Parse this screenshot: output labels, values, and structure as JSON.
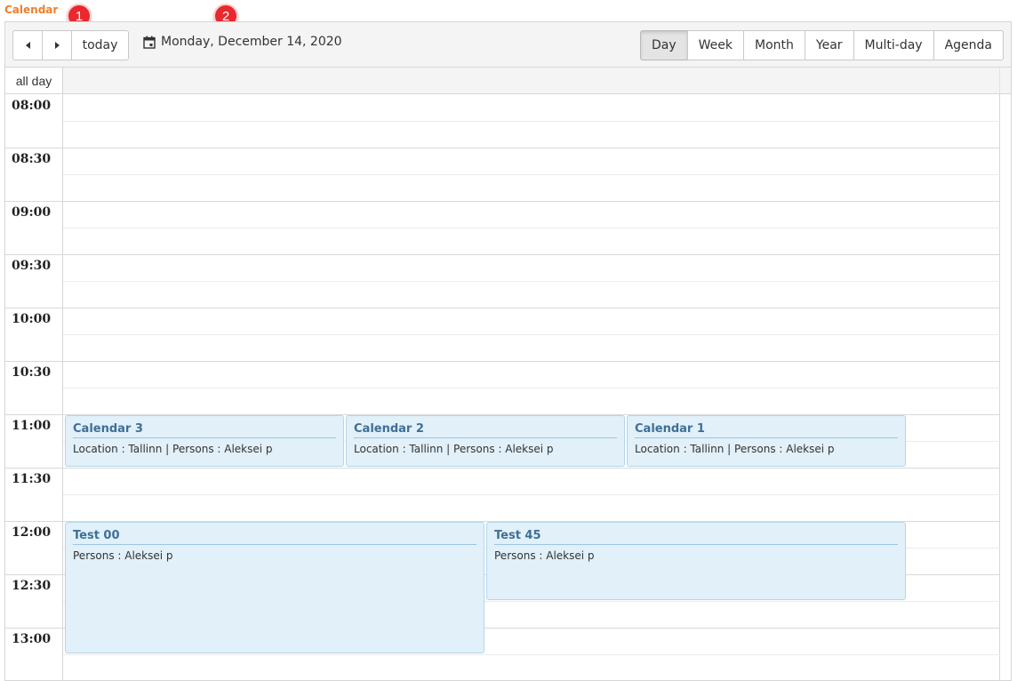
{
  "app": {
    "title": "Calendar"
  },
  "markers": [
    "1",
    "2"
  ],
  "toolbar": {
    "prev_icon": "caret-left-icon",
    "next_icon": "caret-right-icon",
    "today_label": "today",
    "date_icon": "calendar-icon",
    "current_date": "Monday, December 14, 2020",
    "views": [
      "Day",
      "Week",
      "Month",
      "Year",
      "Multi-day",
      "Agenda"
    ],
    "active_view": "Day"
  },
  "allday": {
    "label": "all day"
  },
  "times": [
    "08:00",
    "08:30",
    "09:00",
    "09:30",
    "10:00",
    "10:30",
    "11:00",
    "11:30",
    "12:00",
    "12:30",
    "13:00"
  ],
  "events": [
    {
      "title": "Calendar 3",
      "detail": "Location : Tallinn | Persons : Aleksei p",
      "start": "11:00",
      "end": "11:30"
    },
    {
      "title": "Calendar 2",
      "detail": "Location : Tallinn | Persons : Aleksei p",
      "start": "11:00",
      "end": "11:30"
    },
    {
      "title": "Calendar 1",
      "detail": "Location : Tallinn | Persons : Aleksei p",
      "start": "11:00",
      "end": "11:30"
    },
    {
      "title": "Test 00",
      "detail": "Persons : Aleksei p",
      "start": "12:00",
      "end": "13:15"
    },
    {
      "title": "Test 45",
      "detail": "Persons : Aleksei p",
      "start": "12:00",
      "end": "12:45"
    }
  ],
  "colors": {
    "accent": "#f07f2c",
    "marker": "#e8292f",
    "event_bg": "#e1f0f9",
    "event_border": "#b6d6ea",
    "event_title": "#3e6f97"
  }
}
